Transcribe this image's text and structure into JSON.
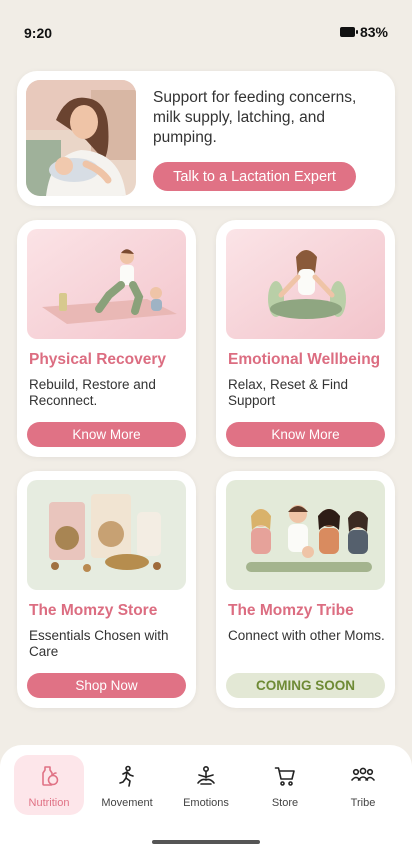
{
  "status": {
    "time": "9:20",
    "battery": "83%"
  },
  "hero": {
    "text": "Support for feeding concerns, milk supply, latching, and pumping.",
    "button": "Talk to a Lactation Expert"
  },
  "tiles": [
    {
      "title": "Physical Recovery",
      "desc": "Rebuild, Restore and Reconnect.",
      "button": "Know More"
    },
    {
      "title": "Emotional Wellbeing",
      "desc": "Relax, Reset & Find Support",
      "button": "Know More"
    },
    {
      "title": "The Momzy Store",
      "desc": "Essentials Chosen with Care",
      "button": "Shop Now"
    },
    {
      "title": "The Momzy Tribe",
      "desc": "Connect with other Moms.",
      "button": "COMING SOON"
    }
  ],
  "nav": [
    {
      "label": "Nutrition",
      "icon": "nutrition-icon",
      "active": true
    },
    {
      "label": "Movement",
      "icon": "movement-icon"
    },
    {
      "label": "Emotions",
      "icon": "meditation-icon"
    },
    {
      "label": "Store",
      "icon": "cart-icon"
    },
    {
      "label": "Tribe",
      "icon": "group-icon"
    }
  ],
  "colors": {
    "accent": "#e07285",
    "title": "#dc6d81",
    "background": "#f1ede6",
    "coming_soon_bg": "#e3e8d5",
    "coming_soon_text": "#6e8a35"
  }
}
